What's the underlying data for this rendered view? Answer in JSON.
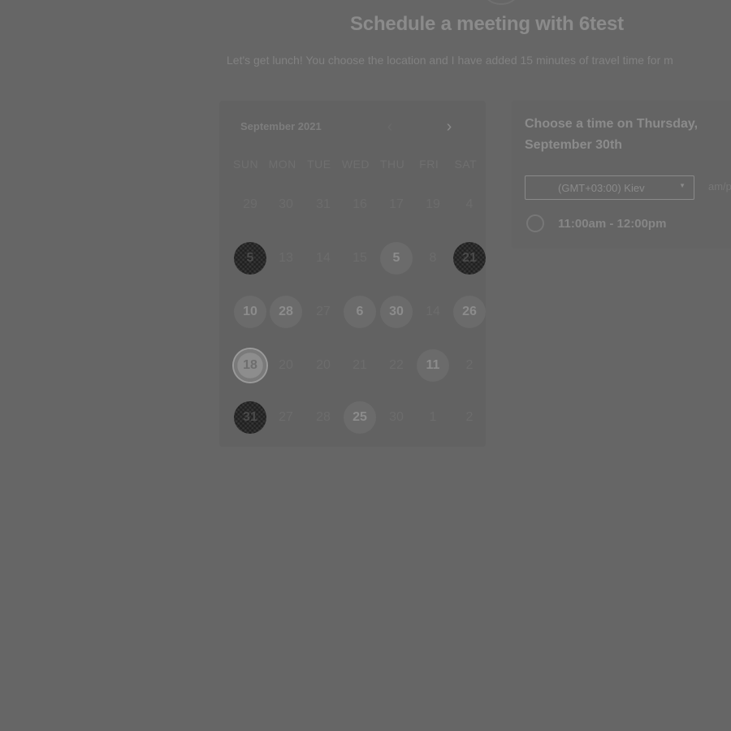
{
  "header": {
    "title": "Schedule a meeting with 6test",
    "description": "Let's get lunch! You choose the location and I have added 15 minutes of travel time for m"
  },
  "calendar": {
    "month": "September 2021",
    "prev_icon": "chevron-left-icon",
    "next_icon": "chevron-right-icon",
    "weekdays": [
      "SUN",
      "MON",
      "TUE",
      "WED",
      "THU",
      "FRI",
      "SAT"
    ],
    "days": [
      {
        "label": "29",
        "state": "dim"
      },
      {
        "label": "30",
        "state": "dim"
      },
      {
        "label": "31",
        "state": "dim"
      },
      {
        "label": "16",
        "state": "dim"
      },
      {
        "label": "17",
        "state": "dim"
      },
      {
        "label": "19",
        "state": "dim"
      },
      {
        "label": "4",
        "state": "dim"
      },
      {
        "label": "5",
        "state": "noisy"
      },
      {
        "label": "13",
        "state": "dim"
      },
      {
        "label": "14",
        "state": "dim"
      },
      {
        "label": "15",
        "state": "dim"
      },
      {
        "label": "5",
        "state": "available"
      },
      {
        "label": "8",
        "state": "dim"
      },
      {
        "label": "21",
        "state": "noisy"
      },
      {
        "label": "10",
        "state": "available"
      },
      {
        "label": "28",
        "state": "available"
      },
      {
        "label": "27",
        "state": "dim"
      },
      {
        "label": "6",
        "state": "available"
      },
      {
        "label": "30",
        "state": "available"
      },
      {
        "label": "14",
        "state": "dim"
      },
      {
        "label": "26",
        "state": "available"
      },
      {
        "label": "18",
        "state": "selected"
      },
      {
        "label": "20",
        "state": "dim"
      },
      {
        "label": "20",
        "state": "dim"
      },
      {
        "label": "21",
        "state": "dim"
      },
      {
        "label": "22",
        "state": "dim"
      },
      {
        "label": "11",
        "state": "available"
      },
      {
        "label": "2",
        "state": "dim"
      },
      {
        "label": "31",
        "state": "noisy"
      },
      {
        "label": "27",
        "state": "dim"
      },
      {
        "label": "28",
        "state": "dim"
      },
      {
        "label": "25",
        "state": "available"
      },
      {
        "label": "30",
        "state": "dim"
      },
      {
        "label": "1",
        "state": "dim"
      },
      {
        "label": "2",
        "state": "dim"
      }
    ]
  },
  "times": {
    "heading": "Choose a time on Thursday, September 30th",
    "timezone": "(GMT+03:00) Kiev",
    "caret_icon": "caret-down-icon",
    "ampm": "am/pm",
    "slots": [
      "11:00am - 12:00pm"
    ]
  }
}
